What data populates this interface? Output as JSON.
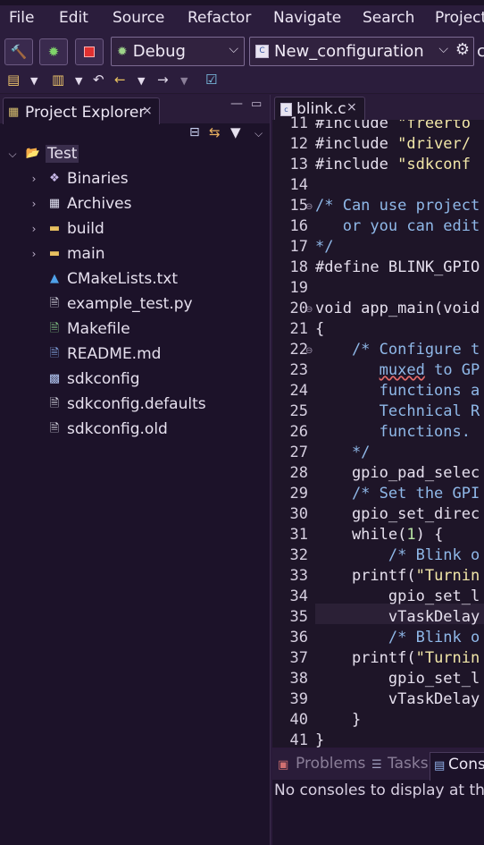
{
  "menu": [
    "File",
    "Edit",
    "Source",
    "Refactor",
    "Navigate",
    "Search",
    "Project"
  ],
  "toolbar": {
    "launch_mode": "Debug",
    "launch_config": "New_configuration",
    "truncated_label": "c"
  },
  "explorer": {
    "tab_label": "Project Explorer",
    "project": "Test",
    "items": [
      {
        "label": "Binaries",
        "kind": "binaries"
      },
      {
        "label": "Archives",
        "kind": "archives"
      },
      {
        "label": "build",
        "kind": "folder"
      },
      {
        "label": "main",
        "kind": "folder"
      },
      {
        "label": "CMakeLists.txt",
        "kind": "cmake"
      },
      {
        "label": "example_test.py",
        "kind": "file"
      },
      {
        "label": "Makefile",
        "kind": "makefile"
      },
      {
        "label": "README.md",
        "kind": "word"
      },
      {
        "label": "sdkconfig",
        "kind": "config"
      },
      {
        "label": "sdkconfig.defaults",
        "kind": "file"
      },
      {
        "label": "sdkconfig.old",
        "kind": "file"
      }
    ]
  },
  "editor": {
    "tab_label": "blink.c",
    "lines": [
      {
        "n": "11",
        "text": "#include \"freerto"
      },
      {
        "n": "12",
        "text": "#include \"driver/"
      },
      {
        "n": "13",
        "text": "#include \"sdkconf"
      },
      {
        "n": "14",
        "text": ""
      },
      {
        "n": "15",
        "text": "/* Can use project"
      },
      {
        "n": "16",
        "text": "   or you can edit"
      },
      {
        "n": "17",
        "text": "*/"
      },
      {
        "n": "18",
        "text": "#define BLINK_GPIO"
      },
      {
        "n": "19",
        "text": ""
      },
      {
        "n": "20",
        "text": "void app_main(void"
      },
      {
        "n": "21",
        "text": "{"
      },
      {
        "n": "22",
        "text": "    /* Configure t"
      },
      {
        "n": "23",
        "text": "       muxed to GP"
      },
      {
        "n": "24",
        "text": "       functions a"
      },
      {
        "n": "25",
        "text": "       Technical R"
      },
      {
        "n": "26",
        "text": "       functions."
      },
      {
        "n": "27",
        "text": "    */"
      },
      {
        "n": "28",
        "text": "    gpio_pad_selec"
      },
      {
        "n": "29",
        "text": "    /* Set the GPI"
      },
      {
        "n": "30",
        "text": "    gpio_set_direc"
      },
      {
        "n": "31",
        "text": "    while(1) {"
      },
      {
        "n": "32",
        "text": "        /* Blink o"
      },
      {
        "n": "33",
        "text": "    printf(\"Turnin"
      },
      {
        "n": "34",
        "text": "        gpio_set_l"
      },
      {
        "n": "35",
        "text": "        vTaskDelay"
      },
      {
        "n": "36",
        "text": "        /* Blink o"
      },
      {
        "n": "37",
        "text": "    printf(\"Turnin"
      },
      {
        "n": "38",
        "text": "        gpio_set_l"
      },
      {
        "n": "39",
        "text": "        vTaskDelay"
      },
      {
        "n": "40",
        "text": "    }"
      },
      {
        "n": "41",
        "text": "}"
      }
    ]
  },
  "bottom": {
    "tabs": [
      "Problems",
      "Tasks",
      "Cons"
    ],
    "message": "No consoles to display at this"
  }
}
